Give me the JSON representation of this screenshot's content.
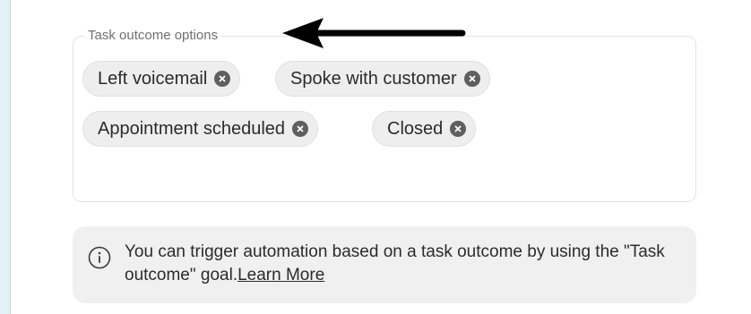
{
  "field": {
    "legend": "Task outcome options"
  },
  "chips": [
    {
      "label": "Left voicemail"
    },
    {
      "label": "Spoke with customer"
    },
    {
      "label": "Appointment scheduled"
    },
    {
      "label": "Closed"
    }
  ],
  "info": {
    "text": "You can trigger automation based on a task outcome by using the \"Task outcome\" goal.",
    "link_label": "Learn More"
  },
  "colors": {
    "chip_bg": "#eeeeee",
    "info_bg": "#f0f0f0",
    "annotation_arrow": "#000000"
  },
  "icons": {
    "chip_remove": "circle-x-icon",
    "info": "info-circle-icon",
    "annotation": "arrow-left-icon"
  }
}
